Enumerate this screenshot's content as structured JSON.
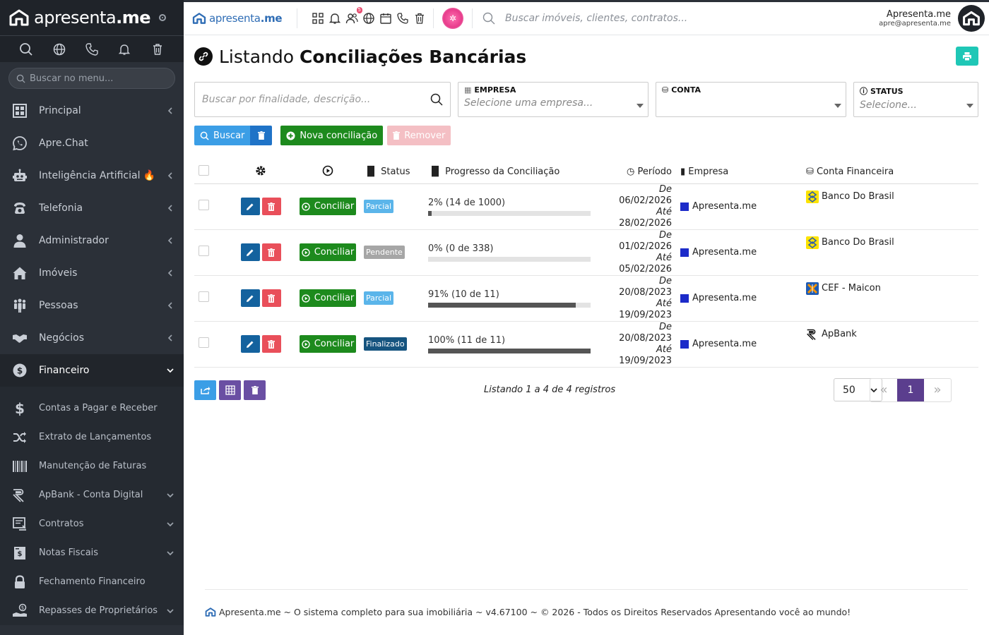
{
  "sidebar": {
    "brand": {
      "name_light": "apresenta",
      "name_bold": ".me"
    },
    "search_placeholder": "Buscar no menu...",
    "items": [
      {
        "label": "Principal",
        "icon": "grid-icon",
        "chevron": true
      },
      {
        "label": "Apre.Chat",
        "icon": "whatsapp-icon",
        "chevron": false
      },
      {
        "label": "Inteligência Artificial 🔥",
        "icon": "robot-icon",
        "chevron": true
      },
      {
        "label": "Telefonia",
        "icon": "phone-icon",
        "chevron": true
      },
      {
        "label": "Administrador",
        "icon": "user-icon",
        "chevron": true
      },
      {
        "label": "Imóveis",
        "icon": "home-icon",
        "chevron": true
      },
      {
        "label": "Pessoas",
        "icon": "people-icon",
        "chevron": true
      },
      {
        "label": "Negócios",
        "icon": "handshake-icon",
        "chevron": true
      },
      {
        "label": "Financeiro",
        "icon": "dollar-circle-icon",
        "chevron": true,
        "active": true
      }
    ],
    "submenu": [
      {
        "label": "Contas a Pagar e Receber",
        "icon": "dollar-icon",
        "chevron": false
      },
      {
        "label": "Extrato de Lançamentos",
        "icon": "shuffle-icon",
        "chevron": false
      },
      {
        "label": "Manutenção de Faturas",
        "icon": "barcode-icon",
        "chevron": false
      },
      {
        "label": "ApBank - Conta Digital",
        "icon": "apbank-icon",
        "chevron": true
      },
      {
        "label": "Contratos",
        "icon": "contract-icon",
        "chevron": true
      },
      {
        "label": "Notas Fiscais",
        "icon": "invoice-icon",
        "chevron": true
      },
      {
        "label": "Fechamento Financeiro",
        "icon": "lock-icon",
        "chevron": false
      },
      {
        "label": "Repasses de Proprietários",
        "icon": "payout-icon",
        "chevron": true
      }
    ]
  },
  "topbar": {
    "brand": {
      "name_light": "apresenta",
      "name_bold": ".me"
    },
    "notification_badge": "5",
    "search_placeholder": "Buscar imóveis, clientes, contratos...",
    "user_name": "Apresenta.me",
    "user_email": "apre@apresenta.me"
  },
  "page": {
    "title_prefix": "Listando",
    "title_bold": "Conciliações Bancárias"
  },
  "filters": {
    "search_placeholder": "Buscar por finalidade, descrição...",
    "empresa": {
      "label": "EMPRESA",
      "placeholder": "Selecione uma empresa..."
    },
    "conta": {
      "label": "CONTA",
      "placeholder": ""
    },
    "status": {
      "label": "STATUS",
      "placeholder": "Selecione..."
    }
  },
  "actions": {
    "buscar": "Buscar",
    "nova": "Nova conciliação",
    "remover": "Remover"
  },
  "table": {
    "headers": {
      "status": "Status",
      "progresso": "Progresso da Conciliação",
      "periodo": "Período",
      "empresa": "Empresa",
      "conta": "Conta Financeira"
    },
    "conciliar_label": "Conciliar",
    "de_label": "De",
    "ate_label": "Até",
    "rows": [
      {
        "status": "Parcial",
        "status_class": "st-parcial",
        "progress_text": "2% (14 de 1000)",
        "progress_pct": 2,
        "de": "06/02/2026",
        "ate": "28/02/2026",
        "empresa": "Apresenta.me",
        "conta": "Banco Do Brasil",
        "bank_icon": "bb-icon"
      },
      {
        "status": "Pendente",
        "status_class": "st-pendente",
        "progress_text": "0% (0 de 338)",
        "progress_pct": 0,
        "de": "01/02/2026",
        "ate": "05/02/2026",
        "empresa": "Apresenta.me",
        "conta": "Banco Do Brasil",
        "bank_icon": "bb-icon"
      },
      {
        "status": "Parcial",
        "status_class": "st-parcial",
        "progress_text": "91% (10 de 11)",
        "progress_pct": 91,
        "de": "20/08/2023",
        "ate": "19/09/2023",
        "empresa": "Apresenta.me",
        "conta": "CEF - Maicon",
        "bank_icon": "cef-icon"
      },
      {
        "status": "Finalizado",
        "status_class": "st-finalizado",
        "progress_text": "100% (11 de 11)",
        "progress_pct": 100,
        "de": "20/08/2023",
        "ate": "19/09/2023",
        "empresa": "Apresenta.me",
        "conta": "ApBank",
        "bank_icon": "apbank-icon"
      }
    ]
  },
  "pagination": {
    "listing_text": "Listando 1 a 4 de 4 registros",
    "per_page": "50",
    "current_page": "1"
  },
  "footer": {
    "text": "Apresenta.me ~ O sistema completo para sua imobiliária ~ v4.67100 ~ © 2026 - Todos os Direitos Reservados Apresentando você ao mundo!"
  },
  "colors": {
    "sidebar_bg": "#2b3038",
    "accent_blue": "#3b9ee6",
    "success_green": "#1d8a1d",
    "danger_red": "#e94f5a",
    "pager_purple": "#5b3e8e",
    "print_teal": "#1fc7b6"
  }
}
